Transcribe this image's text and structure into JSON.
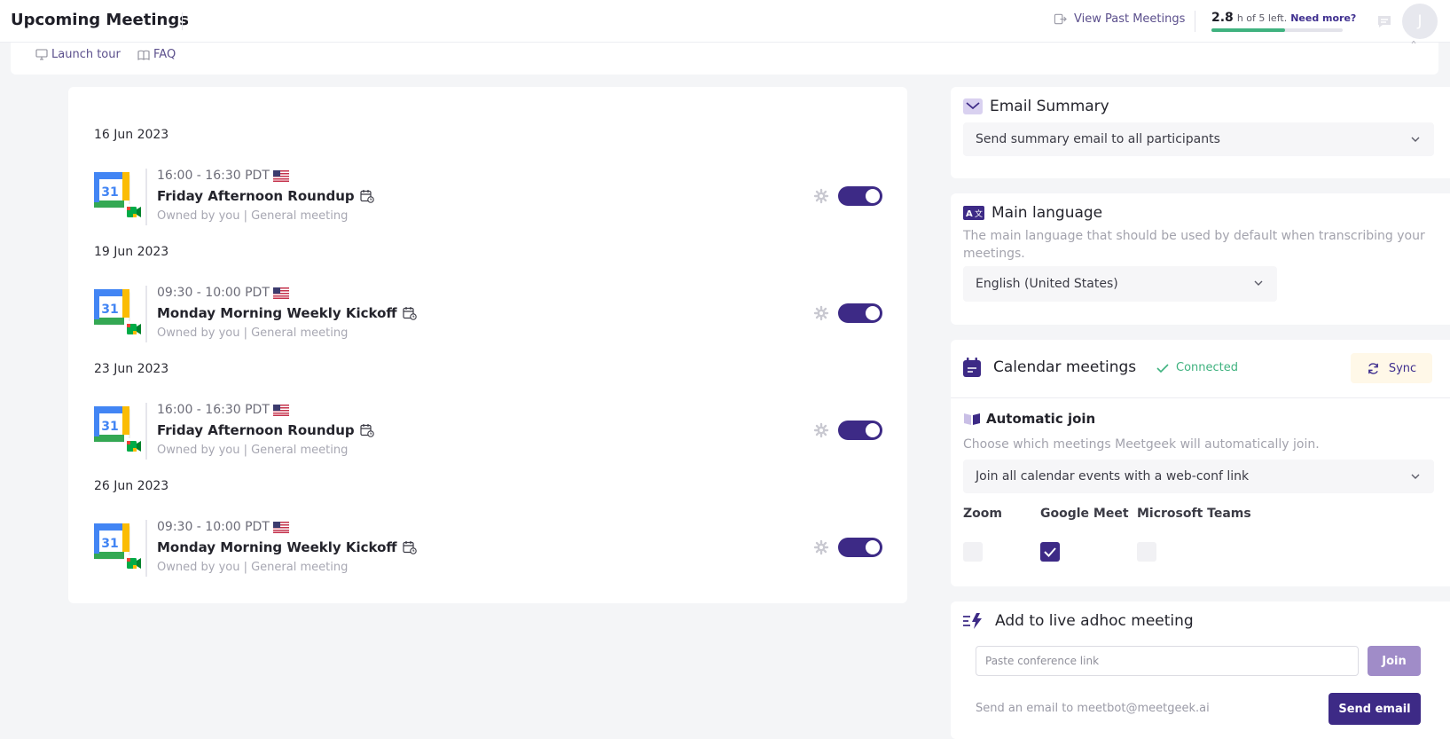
{
  "header": {
    "title": "Upcoming Meetings",
    "past_meetings_label": "View Past Meetings",
    "usage_hours": "2.8",
    "usage_text": "h of 5 left.",
    "need_more_label": "Need more?",
    "usage_fraction": 0.56,
    "avatar_initial": "J"
  },
  "help": {
    "tour_label": "Launch tour",
    "faq_label": "FAQ",
    "close_glyph": "ˆ"
  },
  "meetings": {
    "groups": [
      {
        "date": "16 Jun 2023",
        "time": "16:00 - 16:30 PDT",
        "title": "Friday Afternoon Roundup",
        "subtitle": "Owned by you | General meeting",
        "enabled": true
      },
      {
        "date": "19 Jun 2023",
        "time": "09:30 - 10:00 PDT",
        "title": "Monday Morning Weekly Kickoff",
        "subtitle": "Owned by you | General meeting",
        "enabled": true
      },
      {
        "date": "23 Jun 2023",
        "time": "16:00 - 16:30 PDT",
        "title": "Friday Afternoon Roundup",
        "subtitle": "Owned by you | General meeting",
        "enabled": true
      },
      {
        "date": "26 Jun 2023",
        "time": "09:30 - 10:00 PDT",
        "title": "Monday Morning Weekly Kickoff",
        "subtitle": "Owned by you | General meeting",
        "enabled": true
      }
    ],
    "calendar_day": "31"
  },
  "email_summary": {
    "title": "Email Summary",
    "selected": "Send summary email to all participants"
  },
  "main_language": {
    "title": "Main language",
    "description": "The main language that should be used by default when transcribing your meetings.",
    "selected": "English (United States)"
  },
  "calendar": {
    "title": "Calendar meetings",
    "status": "Connected",
    "sync_label": "Sync",
    "auto_join_title": "Automatic join",
    "auto_join_description": "Choose which meetings Meetgeek will automatically join.",
    "auto_join_selected": "Join all calendar events with a web-conf link",
    "platforms": [
      {
        "name": "Zoom",
        "checked": false
      },
      {
        "name": "Google Meet",
        "checked": true
      },
      {
        "name": "Microsoft Teams",
        "checked": false
      }
    ]
  },
  "adhoc": {
    "title": "Add to live adhoc meeting",
    "link_placeholder": "Paste conference link",
    "join_label": "Join",
    "email_text": "Send an email to meetbot@meetgeek.ai",
    "send_email_label": "Send email"
  },
  "colors": {
    "brand_purple": "#3d2a86",
    "connected_green": "#3fb27f",
    "usage_green": "#3fb27f"
  }
}
